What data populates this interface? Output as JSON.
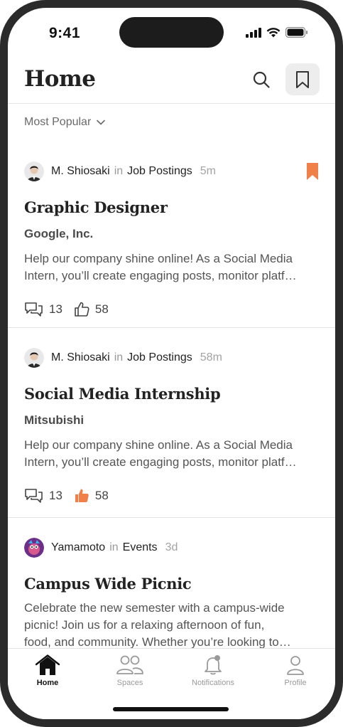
{
  "status_bar": {
    "time": "9:41"
  },
  "header": {
    "title": "Home"
  },
  "sort": {
    "label": "Most Popular"
  },
  "posts": [
    {
      "author": "M. Shiosaki",
      "in": "in",
      "category": "Job Postings",
      "ago": "5m",
      "bookmarked": true,
      "title": "Graphic Designer",
      "company": "Google, Inc.",
      "excerpt_line1": "Help our company shine online! As a Social Media",
      "excerpt_line2": "Intern, you’ll create engaging posts, monitor platf…",
      "comments": "13",
      "likes": "58",
      "liked": false
    },
    {
      "author": "M. Shiosaki",
      "in": "in",
      "category": "Job Postings",
      "ago": "58m",
      "bookmarked": false,
      "title": "Social Media Internship",
      "company": "Mitsubishi",
      "excerpt_line1": "Help our company shine online. As a Social Media",
      "excerpt_line2": "Intern, you’ll create engaging posts, monitor platf…",
      "comments": "13",
      "likes": "58",
      "liked": true
    },
    {
      "author": "Yamamoto",
      "in": "in",
      "category": "Events",
      "ago": "3d",
      "bookmarked": false,
      "title": "Campus Wide Picnic",
      "excerpt_line1": "Celebrate the new semester with a campus-wide",
      "excerpt_line2": "picnic! Join us for a relaxing afternoon of fun,",
      "excerpt_line3": "food, and community. Whether you’re looking to…"
    }
  ],
  "tabs": [
    {
      "label": "Home",
      "icon": "home-icon",
      "active": true
    },
    {
      "label": "Spaces",
      "icon": "people-icon",
      "active": false
    },
    {
      "label": "Notifications",
      "icon": "bell-icon",
      "active": false
    },
    {
      "label": "Profile",
      "icon": "person-icon",
      "active": false
    }
  ],
  "colors": {
    "accent": "#F08048",
    "text": "#222222",
    "muted": "#9A9A9A",
    "divider": "#E3E3E3"
  }
}
